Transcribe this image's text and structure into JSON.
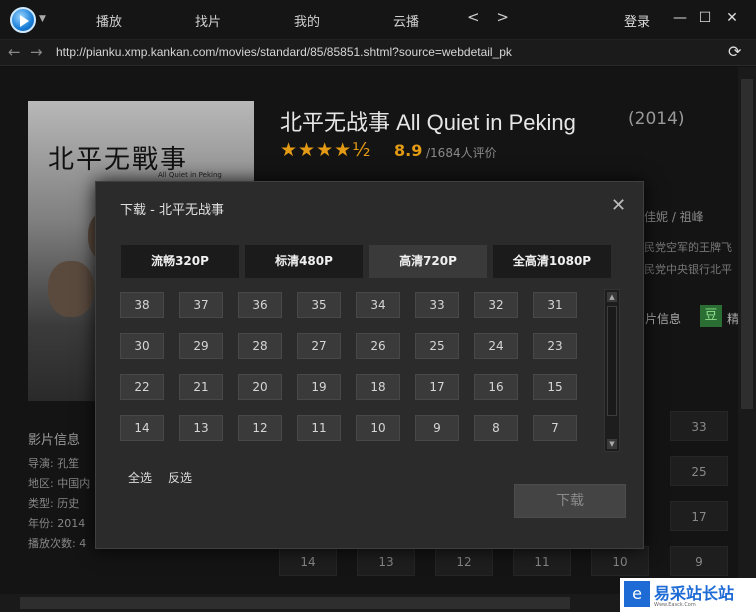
{
  "topbar": {
    "nav": [
      "播放",
      "找片",
      "我的",
      "云播"
    ],
    "arrows": "< >",
    "login": "登录",
    "window_buttons": [
      "minimize-icon",
      "maximize-icon",
      "close-icon"
    ]
  },
  "address_bar": {
    "url": "http://pianku.xmp.kankan.com/movies/standard/85/85851.shtml?source=webdetail_pk"
  },
  "movie": {
    "poster_title": "北平无戰事",
    "poster_subtitle": "All Quiet in Peking",
    "title": "北平无战事 All Quiet in Peking",
    "year": "(2014)",
    "stars": "★★★★½",
    "score": "8.9",
    "votes": "/1684人评价",
    "cast_fragment": "佳妮 / 祖峰",
    "desc_line1": "民党空军的王牌飞",
    "desc_line2": "民党中央银行北平",
    "more_info": "片信息",
    "douban_badge": "豆",
    "douban_text": "精",
    "info_title": "影片信息",
    "info_rows": [
      "导演: 孔笙",
      "地区: 中国内",
      "类型: 历史",
      "年份: 2014",
      "播放次数: 4"
    ]
  },
  "background_episodes": [
    "33",
    "25",
    "17",
    "14",
    "13",
    "12",
    "11",
    "10",
    "9"
  ],
  "dialog": {
    "title": "下载 - 北平无战事",
    "quality_tabs": [
      "流畅320P",
      "标清480P",
      "高清720P",
      "全高清1080P"
    ],
    "active_tab": 2,
    "episodes": [
      "38",
      "37",
      "36",
      "35",
      "34",
      "33",
      "32",
      "31",
      "30",
      "29",
      "28",
      "27",
      "26",
      "25",
      "24",
      "23",
      "22",
      "21",
      "20",
      "19",
      "18",
      "17",
      "16",
      "15",
      "14",
      "13",
      "12",
      "11",
      "10",
      "9",
      "8",
      "7"
    ],
    "select_all": "全选",
    "invert_select": "反选",
    "download_button": "下载"
  },
  "watermark": {
    "text": "易采站长站",
    "url": "Www.Easck.Com"
  },
  "colors": {
    "accent_star": "#e39a14",
    "dialog_bg": "#2b2b2b",
    "active_tab": "#3a3a3a"
  }
}
